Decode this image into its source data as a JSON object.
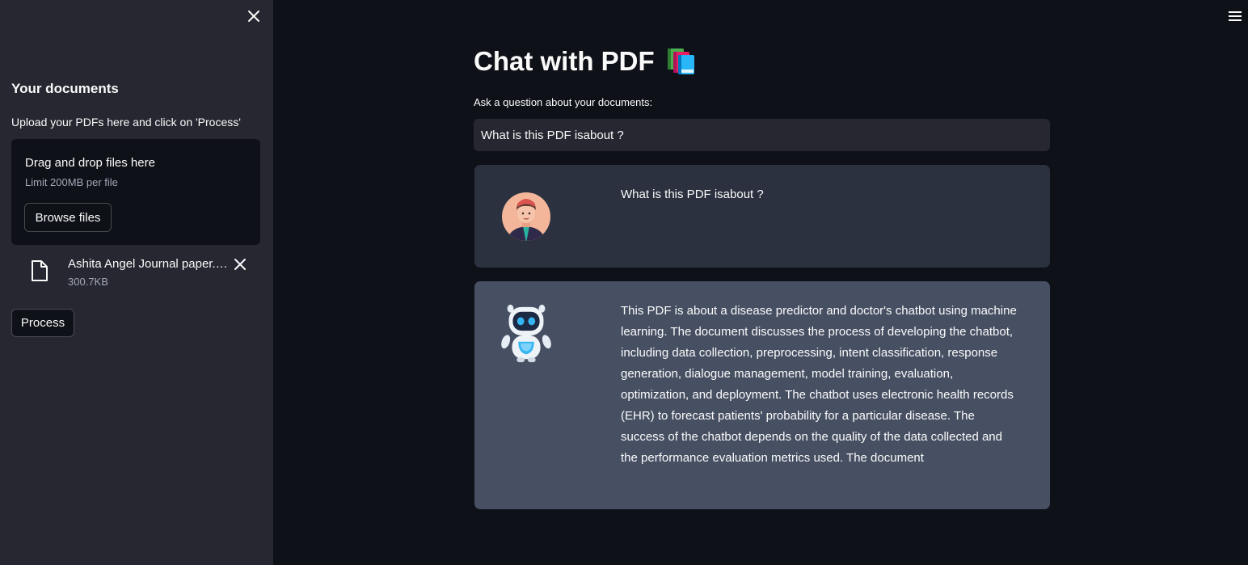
{
  "sidebar": {
    "title": "Your documents",
    "upload_label": "Upload your PDFs here and click on 'Process'",
    "dropzone": {
      "title": "Drag and drop files here",
      "limit": "Limit 200MB per file",
      "browse_label": "Browse files"
    },
    "file": {
      "name": "Ashita Angel Journal paper.pdf",
      "size": "300.7KB"
    },
    "process_label": "Process"
  },
  "main": {
    "title": "Chat with PDF",
    "title_icon": "books-icon",
    "question_label": "Ask a question about your documents:",
    "question_value": "What is this PDF isabout ?",
    "messages": [
      {
        "role": "user",
        "avatar": "user-avatar",
        "text": "What is this PDF isabout ?"
      },
      {
        "role": "bot",
        "avatar": "robot-avatar",
        "text": "This PDF is about a disease predictor and doctor's chatbot using machine learning. The document discusses the process of developing the chatbot, including data collection, preprocessing, intent classification, response generation, dialogue management, model training, evaluation, optimization, and deployment. The chatbot uses electronic health records (EHR) to forecast patients' probability for a particular disease. The success of the chatbot depends on the quality of the data collected and the performance evaluation metrics used. The document"
      }
    ]
  },
  "colors": {
    "background": "#0e1117",
    "sidebar": "#262730",
    "user_message": "#2b313e",
    "bot_message": "#475063",
    "text": "#fafafa"
  }
}
